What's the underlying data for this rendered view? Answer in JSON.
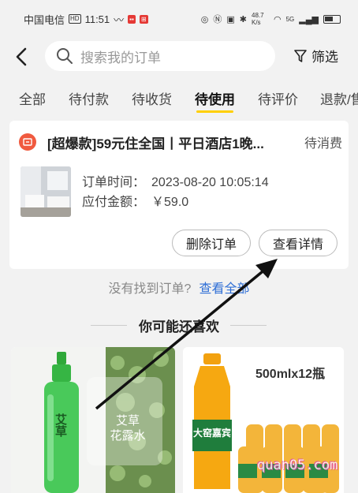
{
  "status_bar": {
    "carrier": "中国电信",
    "hd": "HD",
    "time": "11:51",
    "speed": "48.7 K/s",
    "signal": "5G"
  },
  "search": {
    "placeholder": "搜索我的订单"
  },
  "filter_label": "筛选",
  "tabs": [
    "全部",
    "待付款",
    "待收货",
    "待使用",
    "待评价",
    "退款/售后"
  ],
  "active_tab": "待使用",
  "order": {
    "title": "[超爆款]59元住全国丨平日酒店1晚...",
    "status": "待消费",
    "time_label": "订单时间：",
    "time_value": "2023-08-20 10:05:14",
    "amount_label": "应付金额：",
    "amount_value": "￥59.0",
    "delete_label": "删除订单",
    "detail_label": "查看详情"
  },
  "not_found": {
    "text": "没有找到订单?",
    "link": "查看全部"
  },
  "recommend_title": "你可能还喜欢",
  "products": [
    {
      "label": "艾草花露水",
      "bottle_text": "艾草",
      "image_text": "艾草\n花露水"
    },
    {
      "label": "大窑嘉宾",
      "banner": "500mlx12瓶",
      "brand": "大窑嘉宾"
    }
  ],
  "watermark": "quan05.com",
  "colors": {
    "accent": "#ffcf00",
    "link": "#2f6fd6",
    "hotel_badge": "#f05a3f"
  }
}
